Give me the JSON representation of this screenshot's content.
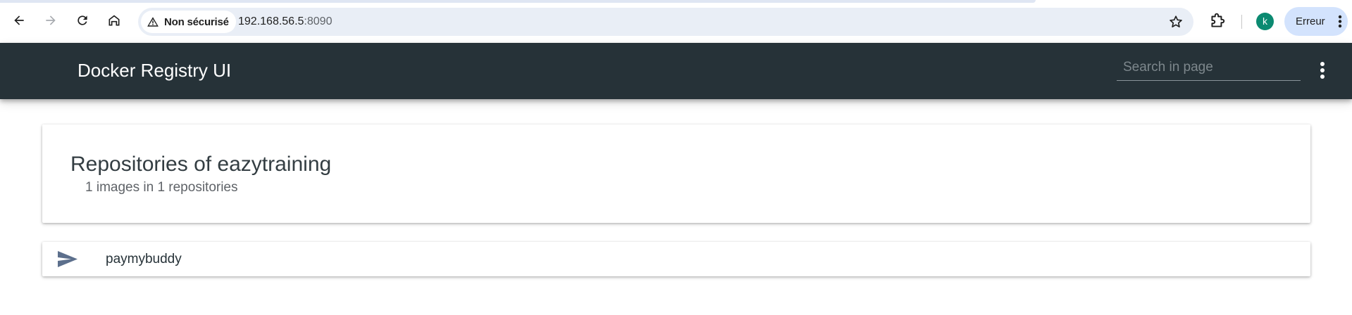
{
  "browser": {
    "security_label": "Non sécurisé",
    "url_host": "192.168.56.5",
    "url_port": ":8090",
    "profile_initial": "k",
    "error_label": "Erreur",
    "icons": [
      "back-icon",
      "forward-icon",
      "reload-icon",
      "home-icon",
      "warning-icon",
      "star-icon",
      "extensions-icon",
      "kebab-icon"
    ]
  },
  "appbar": {
    "title": "Docker Registry UI",
    "search_placeholder": "Search in page",
    "background": "#263238"
  },
  "main": {
    "title": "Repositories of eazytraining",
    "subtitle": "1 images in 1 repositories",
    "repositories": [
      {
        "name": "paymybuddy",
        "icon": "send-icon",
        "icon_color": "#5c6f8c"
      }
    ]
  }
}
